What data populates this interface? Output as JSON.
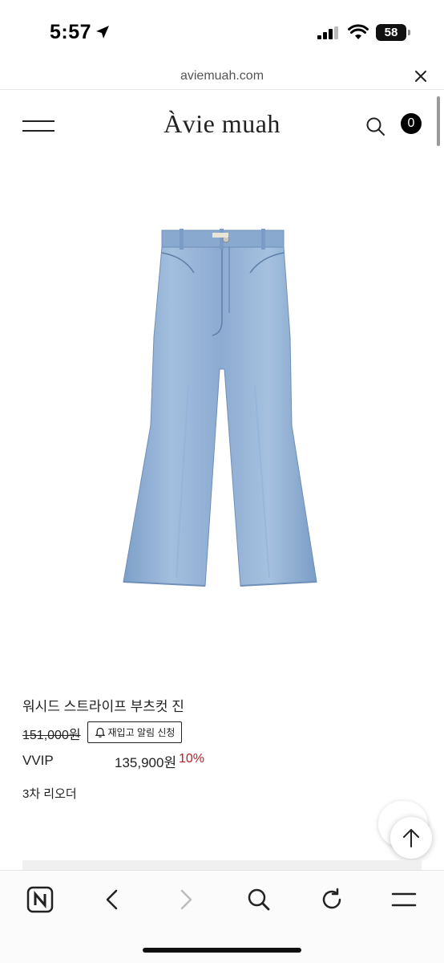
{
  "status": {
    "time": "5:57",
    "battery": "58"
  },
  "url_bar": {
    "domain": "aviemuah.com"
  },
  "header": {
    "logo": "Àvie muah",
    "cart_count": "0"
  },
  "product": {
    "name": "워시드 스트라이프 부츠컷 진",
    "original_price": "151,000원",
    "restock_button": "재입고 알림 신청",
    "vip_label": "VVIP",
    "vip_price": "135,900원",
    "discount": "10%",
    "reorder_note": "3차 리오더"
  },
  "colors": {
    "discount": "#b8202a",
    "denim": "#8eaed3"
  },
  "icons": [
    "location-arrow-icon",
    "signal-icon",
    "wifi-icon",
    "battery-icon",
    "close-icon",
    "menu-icon",
    "search-icon",
    "bell-icon",
    "arrow-up-icon",
    "naver-icon",
    "back-icon",
    "forward-icon",
    "refresh-icon"
  ]
}
